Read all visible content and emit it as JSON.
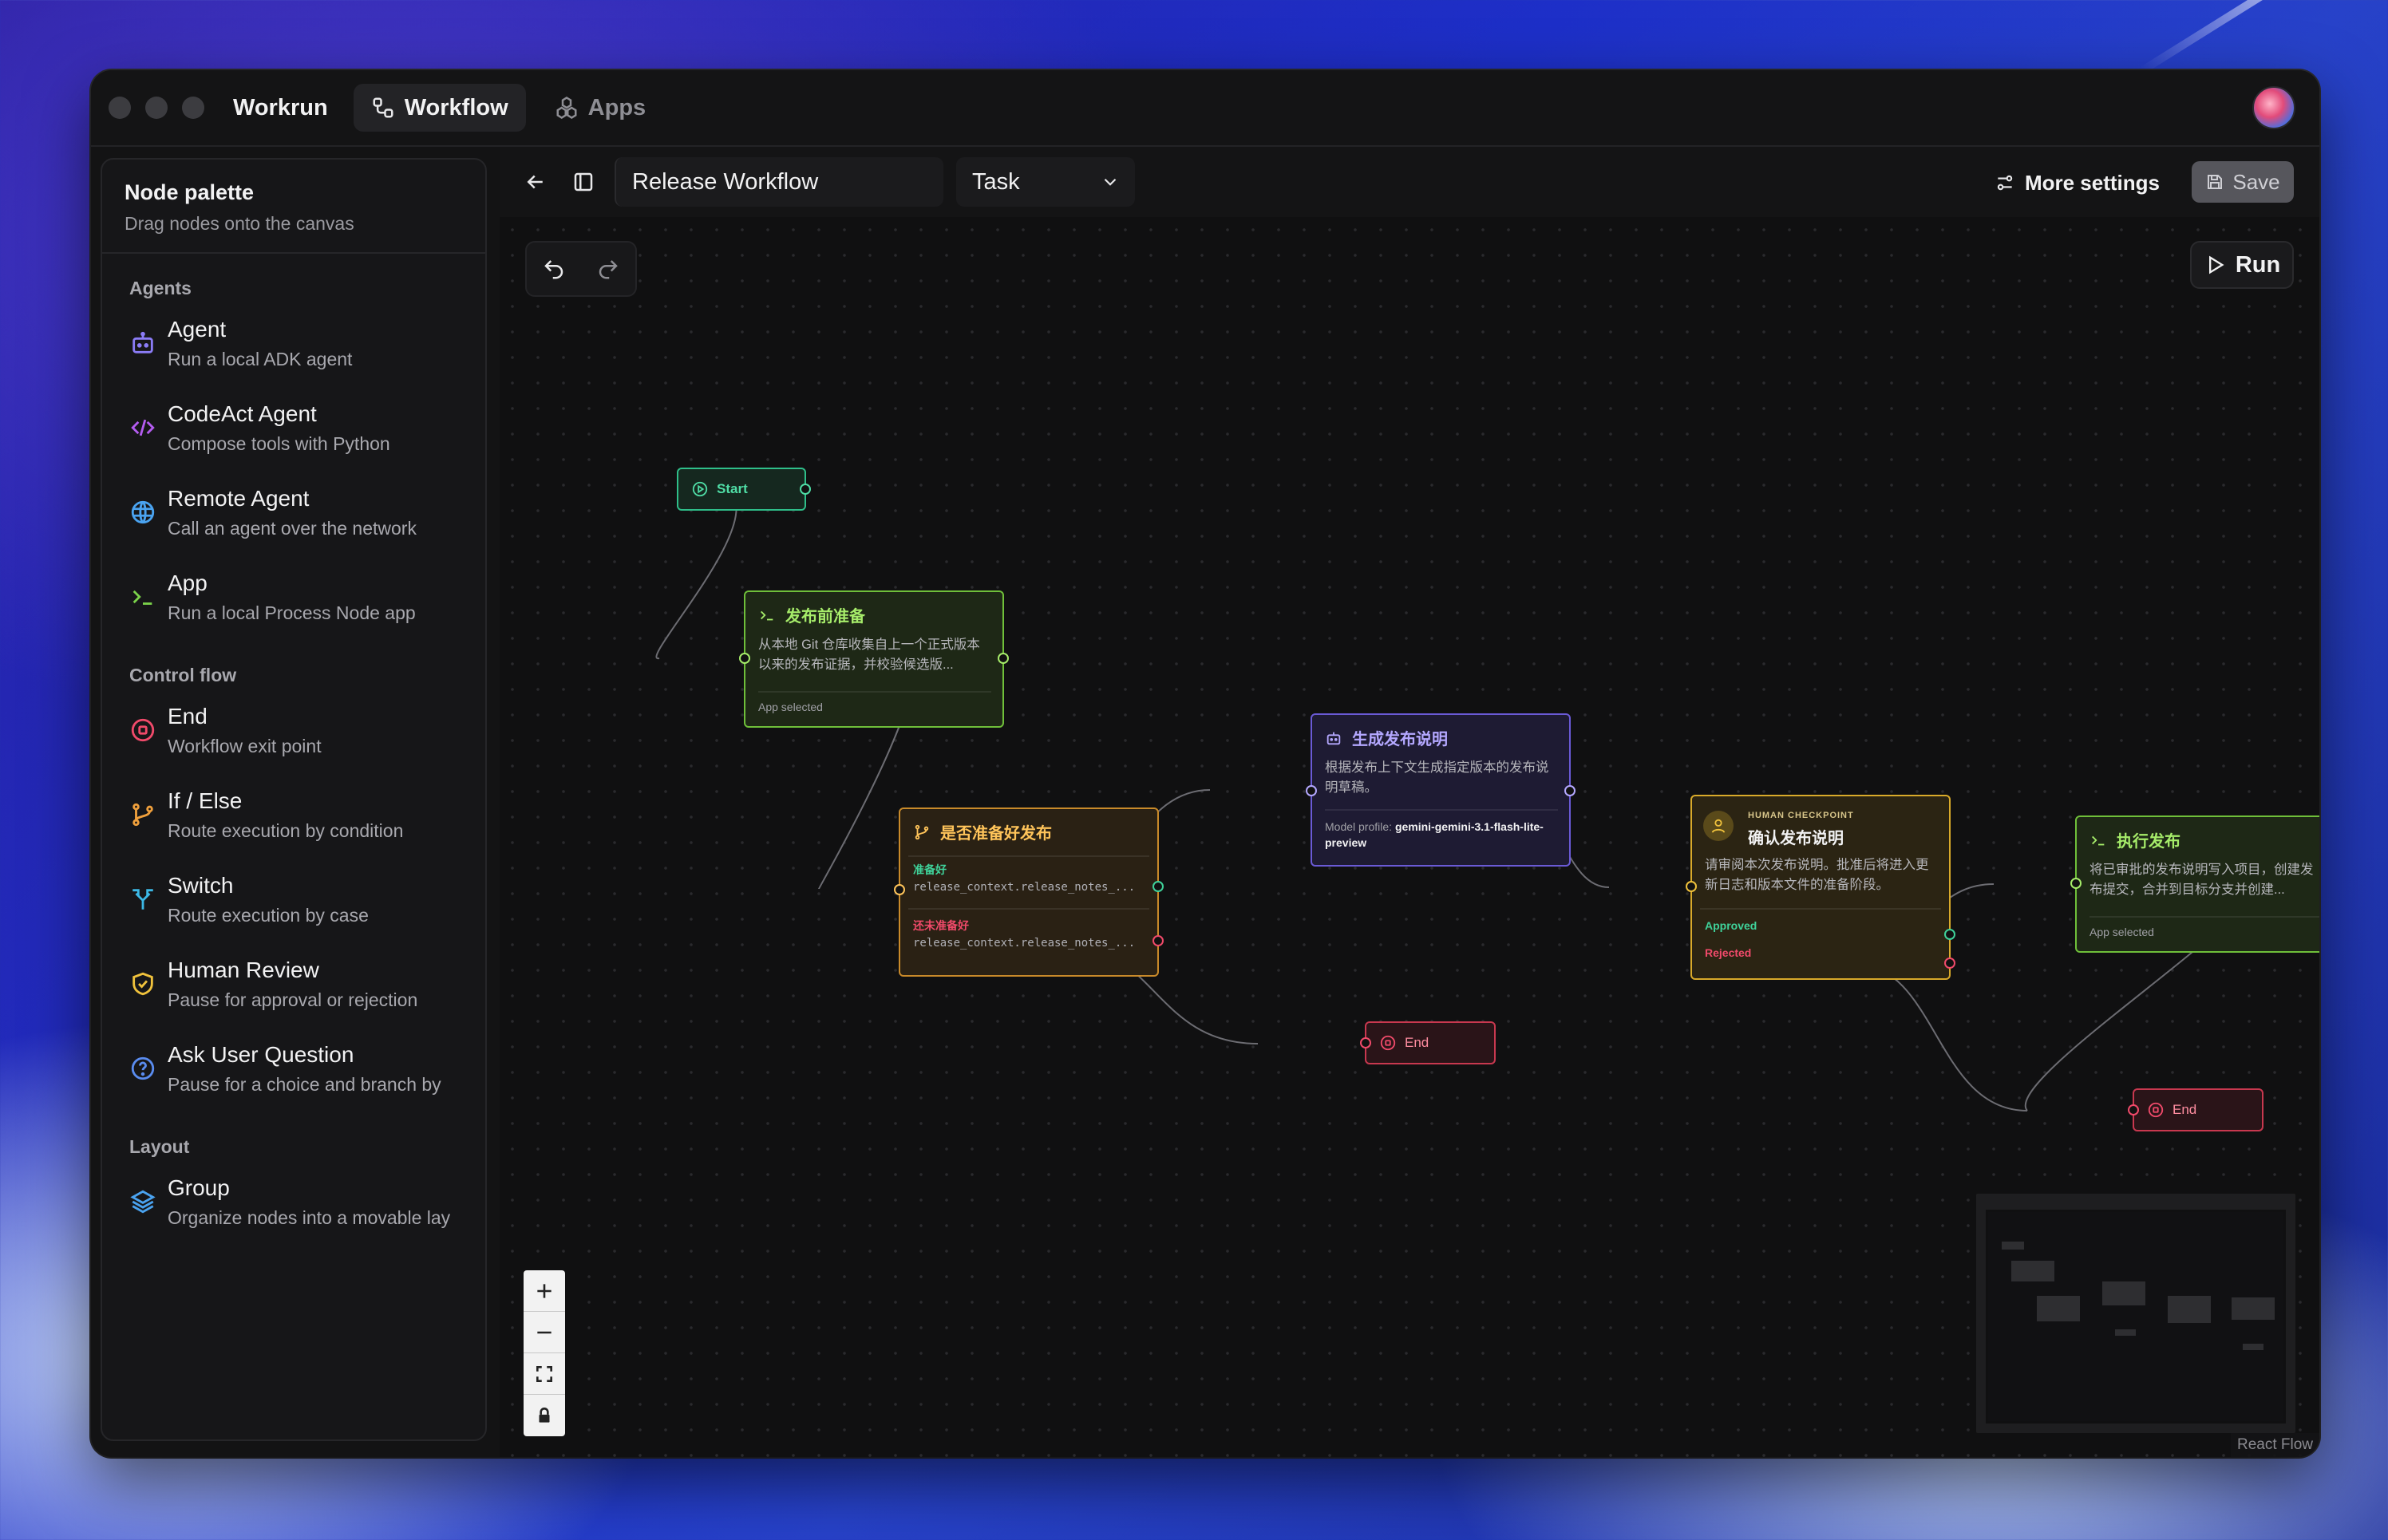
{
  "app": {
    "brand": "Workrun",
    "tabs": [
      {
        "label": "Workflow",
        "icon": "workflow-icon",
        "active": true
      },
      {
        "label": "Apps",
        "icon": "apps-icon",
        "active": false
      }
    ]
  },
  "palette": {
    "title": "Node palette",
    "subtitle": "Drag nodes onto the canvas",
    "sections": {
      "agents": {
        "label": "Agents",
        "items": [
          {
            "name": "Agent",
            "desc": "Run a local ADK agent",
            "icon": "robot-icon",
            "color": "#8b7cf6"
          },
          {
            "name": "CodeAct Agent",
            "desc": "Compose tools with Python",
            "icon": "code-icon",
            "color": "#b45cf0"
          },
          {
            "name": "Remote Agent",
            "desc": "Call an agent over the network",
            "icon": "globe-icon",
            "color": "#4aa3f0"
          },
          {
            "name": "App",
            "desc": "Run a local Process Node app",
            "icon": "terminal-icon",
            "color": "#7bd34a"
          }
        ]
      },
      "control": {
        "label": "Control flow",
        "items": [
          {
            "name": "End",
            "desc": "Workflow exit point",
            "icon": "stop-circle-icon",
            "color": "#f04a6a"
          },
          {
            "name": "If / Else",
            "desc": "Route execution by condition",
            "icon": "branch-icon",
            "color": "#f0a03c"
          },
          {
            "name": "Switch",
            "desc": "Route execution by case",
            "icon": "split-icon",
            "color": "#3cb8e6"
          },
          {
            "name": "Human Review",
            "desc": "Pause for approval or rejection",
            "icon": "shield-icon",
            "color": "#f0c23c"
          },
          {
            "name": "Ask User Question",
            "desc": "Pause for a choice and branch by",
            "icon": "question-icon",
            "color": "#5a8cf0"
          }
        ]
      },
      "layout": {
        "label": "Layout",
        "items": [
          {
            "name": "Group",
            "desc": "Organize nodes into a movable lay",
            "icon": "layers-icon",
            "color": "#4aa3f0"
          }
        ]
      }
    }
  },
  "toolbar": {
    "workflow_name": "Release Workflow",
    "type_select": "Task",
    "more_settings": "More settings",
    "save": "Save"
  },
  "canvas": {
    "run": "Run",
    "attribution": "React Flow",
    "nodes": {
      "start": {
        "label": "Start"
      },
      "prep": {
        "title": "发布前准备",
        "desc": "从本地 Git 仓库收集自上一个正式版本以来的发布证据，并校验候选版...",
        "foot": "App selected"
      },
      "gen": {
        "title": "生成发布说明",
        "desc": "根据发布上下文生成指定版本的发布说明草稿。",
        "foot_label": "Model profile:",
        "foot_value": "gemini-gemini-3.1-flash-lite-preview"
      },
      "ifelse": {
        "title": "是否准备好发布",
        "yes_label": "准备好",
        "yes_cond": "release_context.release_notes_...",
        "no_label": "还未准备好",
        "no_cond": "release_context.release_notes_..."
      },
      "human": {
        "kicker": "HUMAN CHECKPOINT",
        "title": "确认发布说明",
        "desc": "请审阅本次发布说明。批准后将进入更新日志和版本文件的准备阶段。",
        "approved": "Approved",
        "rejected": "Rejected"
      },
      "exec": {
        "title": "执行发布",
        "desc": "将已审批的发布说明写入项目，创建发布提交，合并到目标分支并创建...",
        "foot": "App selected"
      },
      "end1": {
        "label": "End"
      },
      "end2": {
        "label": "End"
      }
    }
  },
  "colors": {
    "start": "#2fbf8a",
    "app": "#7bd34a",
    "agent": "#8b7cf6",
    "ifelse": "#f0a03c",
    "human": "#f0c23c",
    "end": "#f04a6a",
    "approved": "#3fd29a",
    "rejected": "#f04a6a"
  }
}
